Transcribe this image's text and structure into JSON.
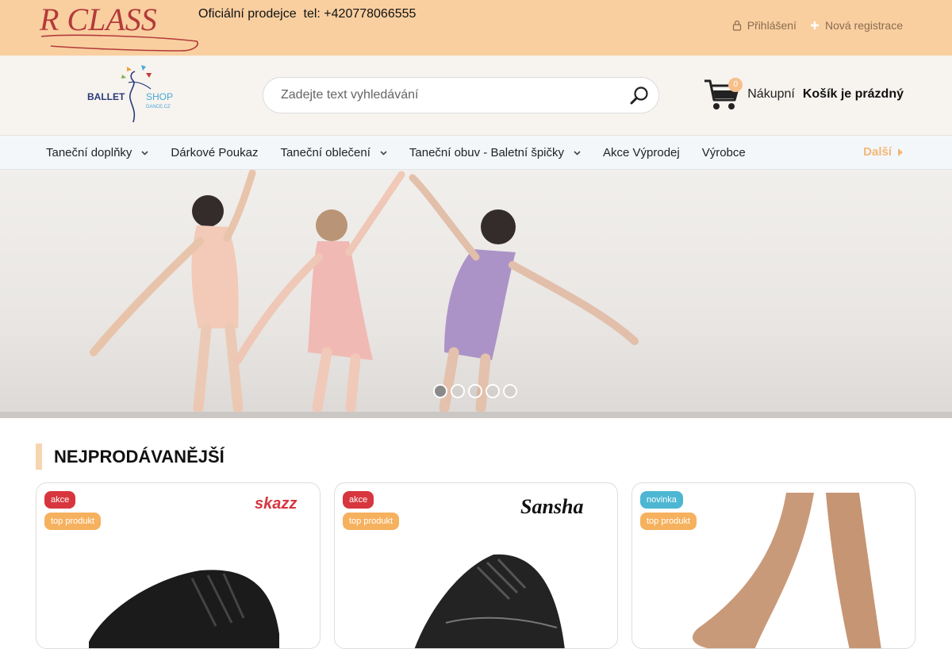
{
  "topbar": {
    "brand_logo": "R CLASS",
    "tagline": "Oficiální prodejce  tel: +420778066555",
    "login_label": "Přihlášení",
    "register_label": "Nová registrace",
    "bg_color": "#f9cfa0"
  },
  "header": {
    "shop_logo_word1": "BALLET",
    "shop_logo_word2": "SHOP",
    "shop_logo_sub": "DANCE.CZ",
    "search_placeholder": "Zadejte text vyhledávání",
    "cart_count": "0",
    "cart_label": "Nákupní",
    "cart_status": "Košík je prázdný"
  },
  "nav": {
    "items": [
      {
        "label": "Taneční doplňky",
        "dropdown": true
      },
      {
        "label": "Dárkové Poukaz",
        "dropdown": false
      },
      {
        "label": "Taneční oblečení",
        "dropdown": true
      },
      {
        "label": "Taneční obuv - Baletní špičky",
        "dropdown": true
      },
      {
        "label": "Akce Výprodej",
        "dropdown": false
      },
      {
        "label": "Výrobce",
        "dropdown": false
      }
    ],
    "more_label": "Další",
    "accent_color": "#f4b779"
  },
  "hero": {
    "slide_count": 5,
    "active_slide": 1
  },
  "section": {
    "title": "NEJPRODÁVANĚJŠÍ"
  },
  "products": [
    {
      "tags": [
        "akce",
        "top produkt"
      ],
      "brand": "skazz"
    },
    {
      "tags": [
        "akce",
        "top produkt"
      ],
      "brand": "Sansha"
    },
    {
      "tags": [
        "novinka",
        "top produkt"
      ],
      "brand": ""
    }
  ]
}
